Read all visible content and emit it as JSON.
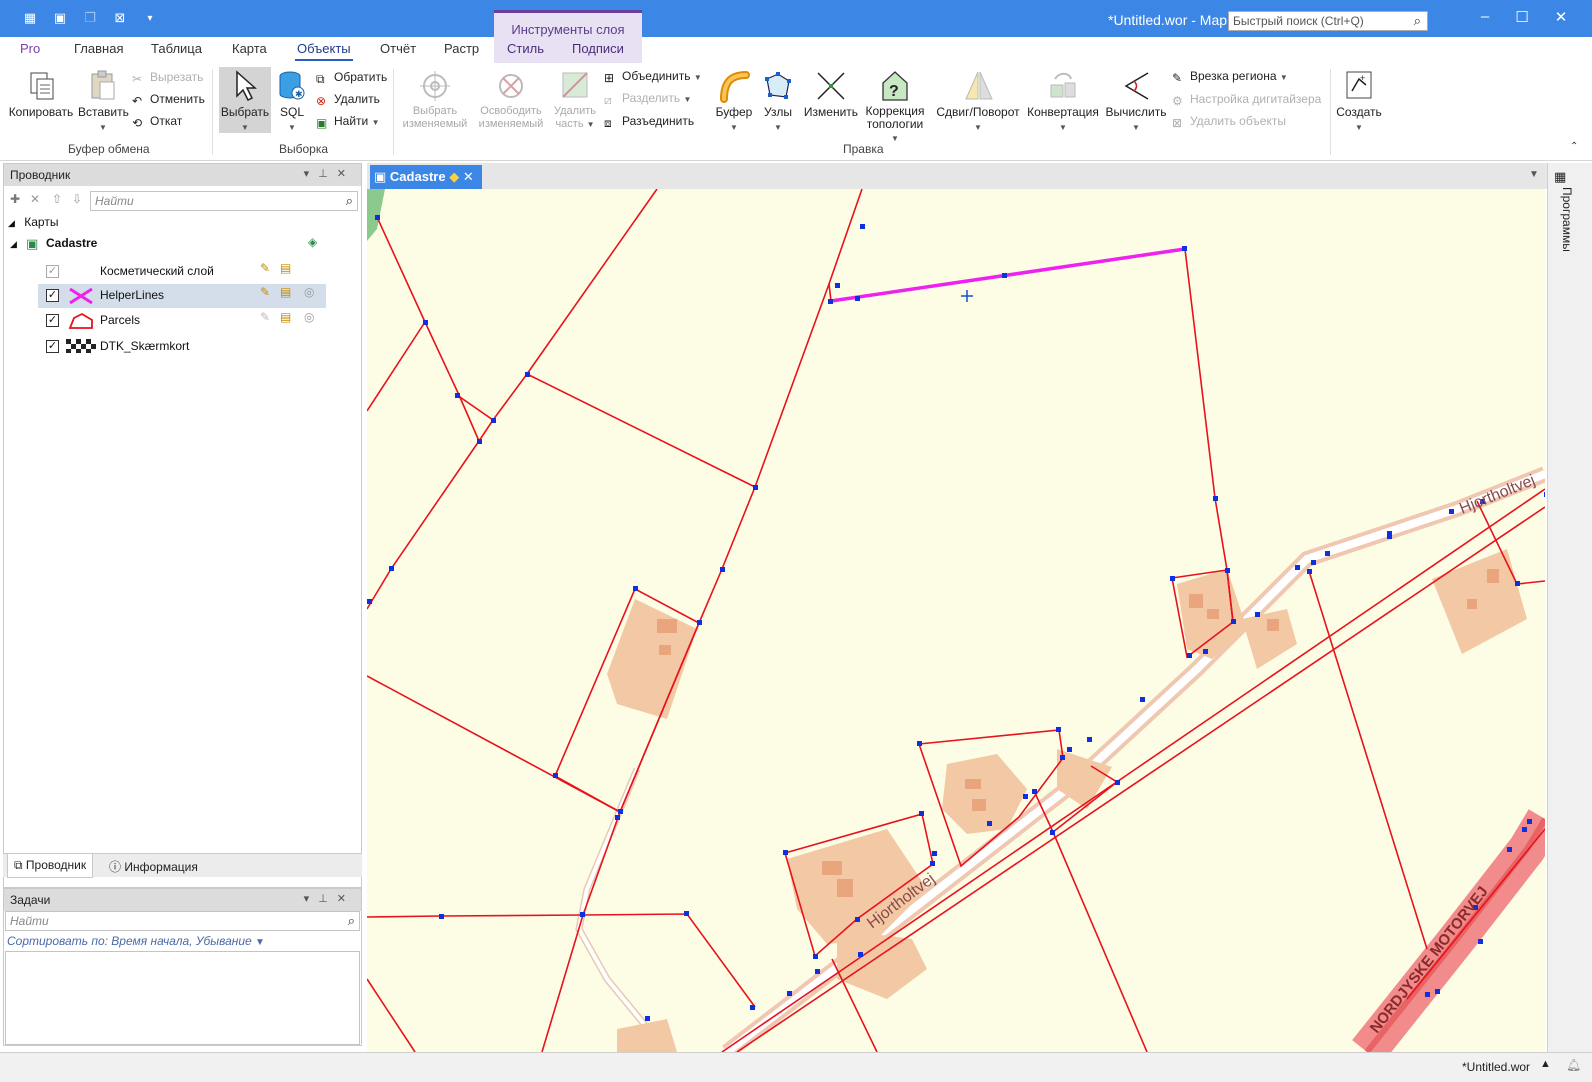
{
  "window": {
    "title": "*Untitled.wor - Map",
    "quick_search_placeholder": "Быстрый поиск (Ctrl+Q)",
    "context_header": "Инструменты слоя",
    "accent": "#3c86e6"
  },
  "menu": {
    "tabs": [
      "Pro",
      "Главная",
      "Таблица",
      "Карта",
      "Объекты",
      "Отчёт",
      "Растр",
      "Стиль",
      "Подписи"
    ],
    "active": "Объекты"
  },
  "ribbon": {
    "clipboard": {
      "copy": "Копировать",
      "paste": "Вставить",
      "cut": "Вырезать",
      "undo": "Отменить",
      "rollback": "Откат",
      "label": "Буфер обмена"
    },
    "selection": {
      "select": "Выбрать",
      "sql": "SQL",
      "invert": "Обратить",
      "delete": "Удалить",
      "find": "Найти",
      "label": "Выборка"
    },
    "edit": {
      "select_editable": "Выбрать изменяемый",
      "release_editable": "Освободить изменяемый",
      "delete_part": "Удалить часть",
      "combine": "Объединить",
      "split": "Разделить",
      "disaggregate": "Разъединить",
      "buffer": "Буфер",
      "nodes": "Узлы",
      "reshape": "Изменить",
      "topology_1": "Коррекция",
      "topology_2": "топологии",
      "shift_rotate": "Сдвиг/Поворот",
      "convert": "Конвертация",
      "compute": "Вычислить",
      "region_inset": "Врезка региона",
      "digitizer_setup": "Настройка дигитайзера",
      "delete_objects": "Удалить объекты",
      "label": "Правка"
    },
    "create": {
      "label": "Создать"
    }
  },
  "explorer": {
    "title": "Проводник",
    "search_placeholder": "Найти",
    "root": "Карты",
    "map_name": "Cadastre",
    "layers": [
      {
        "name": "Косметический слой",
        "checked": true,
        "dim": true
      },
      {
        "name": "HelperLines",
        "checked": true,
        "selected": true
      },
      {
        "name": "Parcels",
        "checked": true
      },
      {
        "name": "DTK_Skærmkort",
        "checked": true
      }
    ]
  },
  "bottom_tabs": {
    "explorer": "Проводник",
    "info": "Информация"
  },
  "tasks": {
    "title": "Задачи",
    "search_placeholder": "Найти",
    "sort_label": "Сортировать по: Время начала, Убывание"
  },
  "document": {
    "tab_title": "Cadastre"
  },
  "map_labels": {
    "road_1": "Hjortholtvej",
    "road_2": "Hjortholtvej",
    "motorway": "NORDJYSKE MOTORVEJ"
  },
  "right_strip": {
    "label": "Программы"
  },
  "status": {
    "workspace": "*Untitled.wor"
  },
  "colors": {
    "parcel_line": "#e8121c",
    "vertex": "#1030e0",
    "helper_line": "#ee22ee",
    "map_bg": "#fdfde6",
    "building": "#f2c9a4"
  }
}
